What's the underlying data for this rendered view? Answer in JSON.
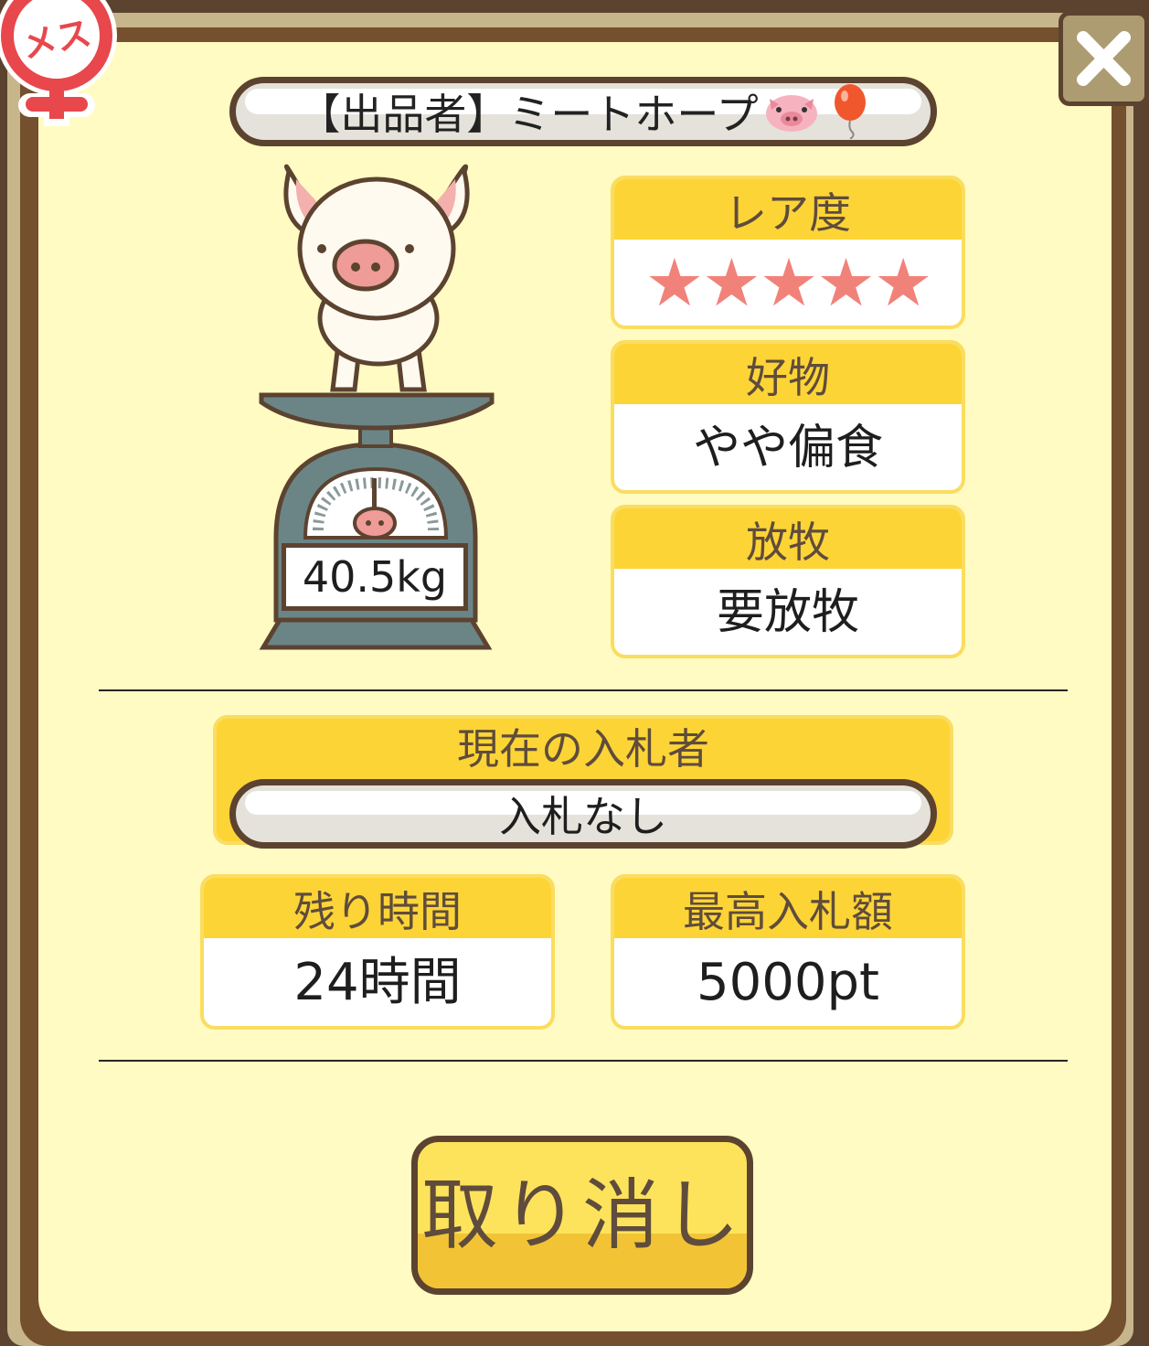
{
  "badge": {
    "gender_label": "メス"
  },
  "seller": {
    "text": "【出品者】ミートホープ"
  },
  "pig": {
    "weight": "40.5kg"
  },
  "rarity": {
    "label": "レア度",
    "stars": "★★★★★",
    "value": 5
  },
  "preference": {
    "label": "好物",
    "value": "やや偏食"
  },
  "grazing": {
    "label": "放牧",
    "value": "要放牧"
  },
  "bidder": {
    "label": "現在の入札者",
    "value": "入札なし"
  },
  "time_left": {
    "label": "残り時間",
    "value": "24時間"
  },
  "max_bid": {
    "label": "最高入札額",
    "value": "5000pt"
  },
  "cancel_button": {
    "label": "取り消し"
  },
  "colors": {
    "accent_yellow": "#fdd436",
    "panel": "#fffbc2",
    "frame": "#74502f",
    "star": "#f1827a",
    "badge_red": "#e8474c"
  }
}
